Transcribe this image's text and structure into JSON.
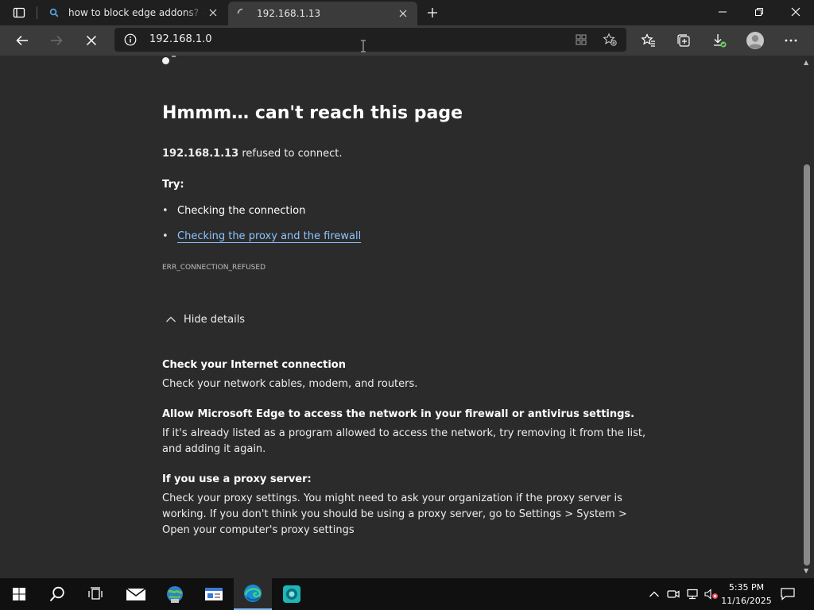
{
  "tabs": [
    {
      "title": "how to block edge addons? - Se",
      "state": "inactive",
      "favicon": "search-icon"
    },
    {
      "title": "192.168.1.13",
      "state": "loading",
      "favicon": "loading-spinner-icon"
    }
  ],
  "address_bar": {
    "url": "192.168.1.0"
  },
  "error_page": {
    "heading": "Hmmm… can't reach this page",
    "host": "192.168.1.13",
    "refused_suffix": " refused to connect.",
    "try_label": "Try:",
    "suggestions": [
      {
        "text": "Checking the connection",
        "link": false
      },
      {
        "text": "Checking the proxy and the firewall",
        "link": true
      }
    ],
    "error_code": "ERR_CONNECTION_REFUSED",
    "details_toggle": "Hide details",
    "details": [
      {
        "heading": "Check your Internet connection",
        "body": "Check your network cables, modem, and routers."
      },
      {
        "heading": "Allow Microsoft Edge to access the network in your firewall or antivirus settings.",
        "body": "If it's already listed as a program allowed to access the network, try removing it from the list, and adding it again."
      },
      {
        "heading": "If you use a proxy server:",
        "body": "Check your proxy settings. You might need to ask your organization if the proxy server is working. If you don't think you should be using a proxy server, go to Settings > System > Open your computer's proxy settings"
      }
    ]
  },
  "taskbar": {
    "time": "5:35 PM",
    "date": "11/16/2025",
    "apps": [
      "start-icon",
      "search-icon",
      "task-view-icon",
      "mail-icon",
      "network-globe-icon",
      "app-window-icon",
      "edge-icon",
      "teal-app-icon"
    ]
  },
  "colors": {
    "link": "#8cc4ff",
    "background": "#2b2b2b",
    "taskbar_accent": "#7fb7f0"
  }
}
